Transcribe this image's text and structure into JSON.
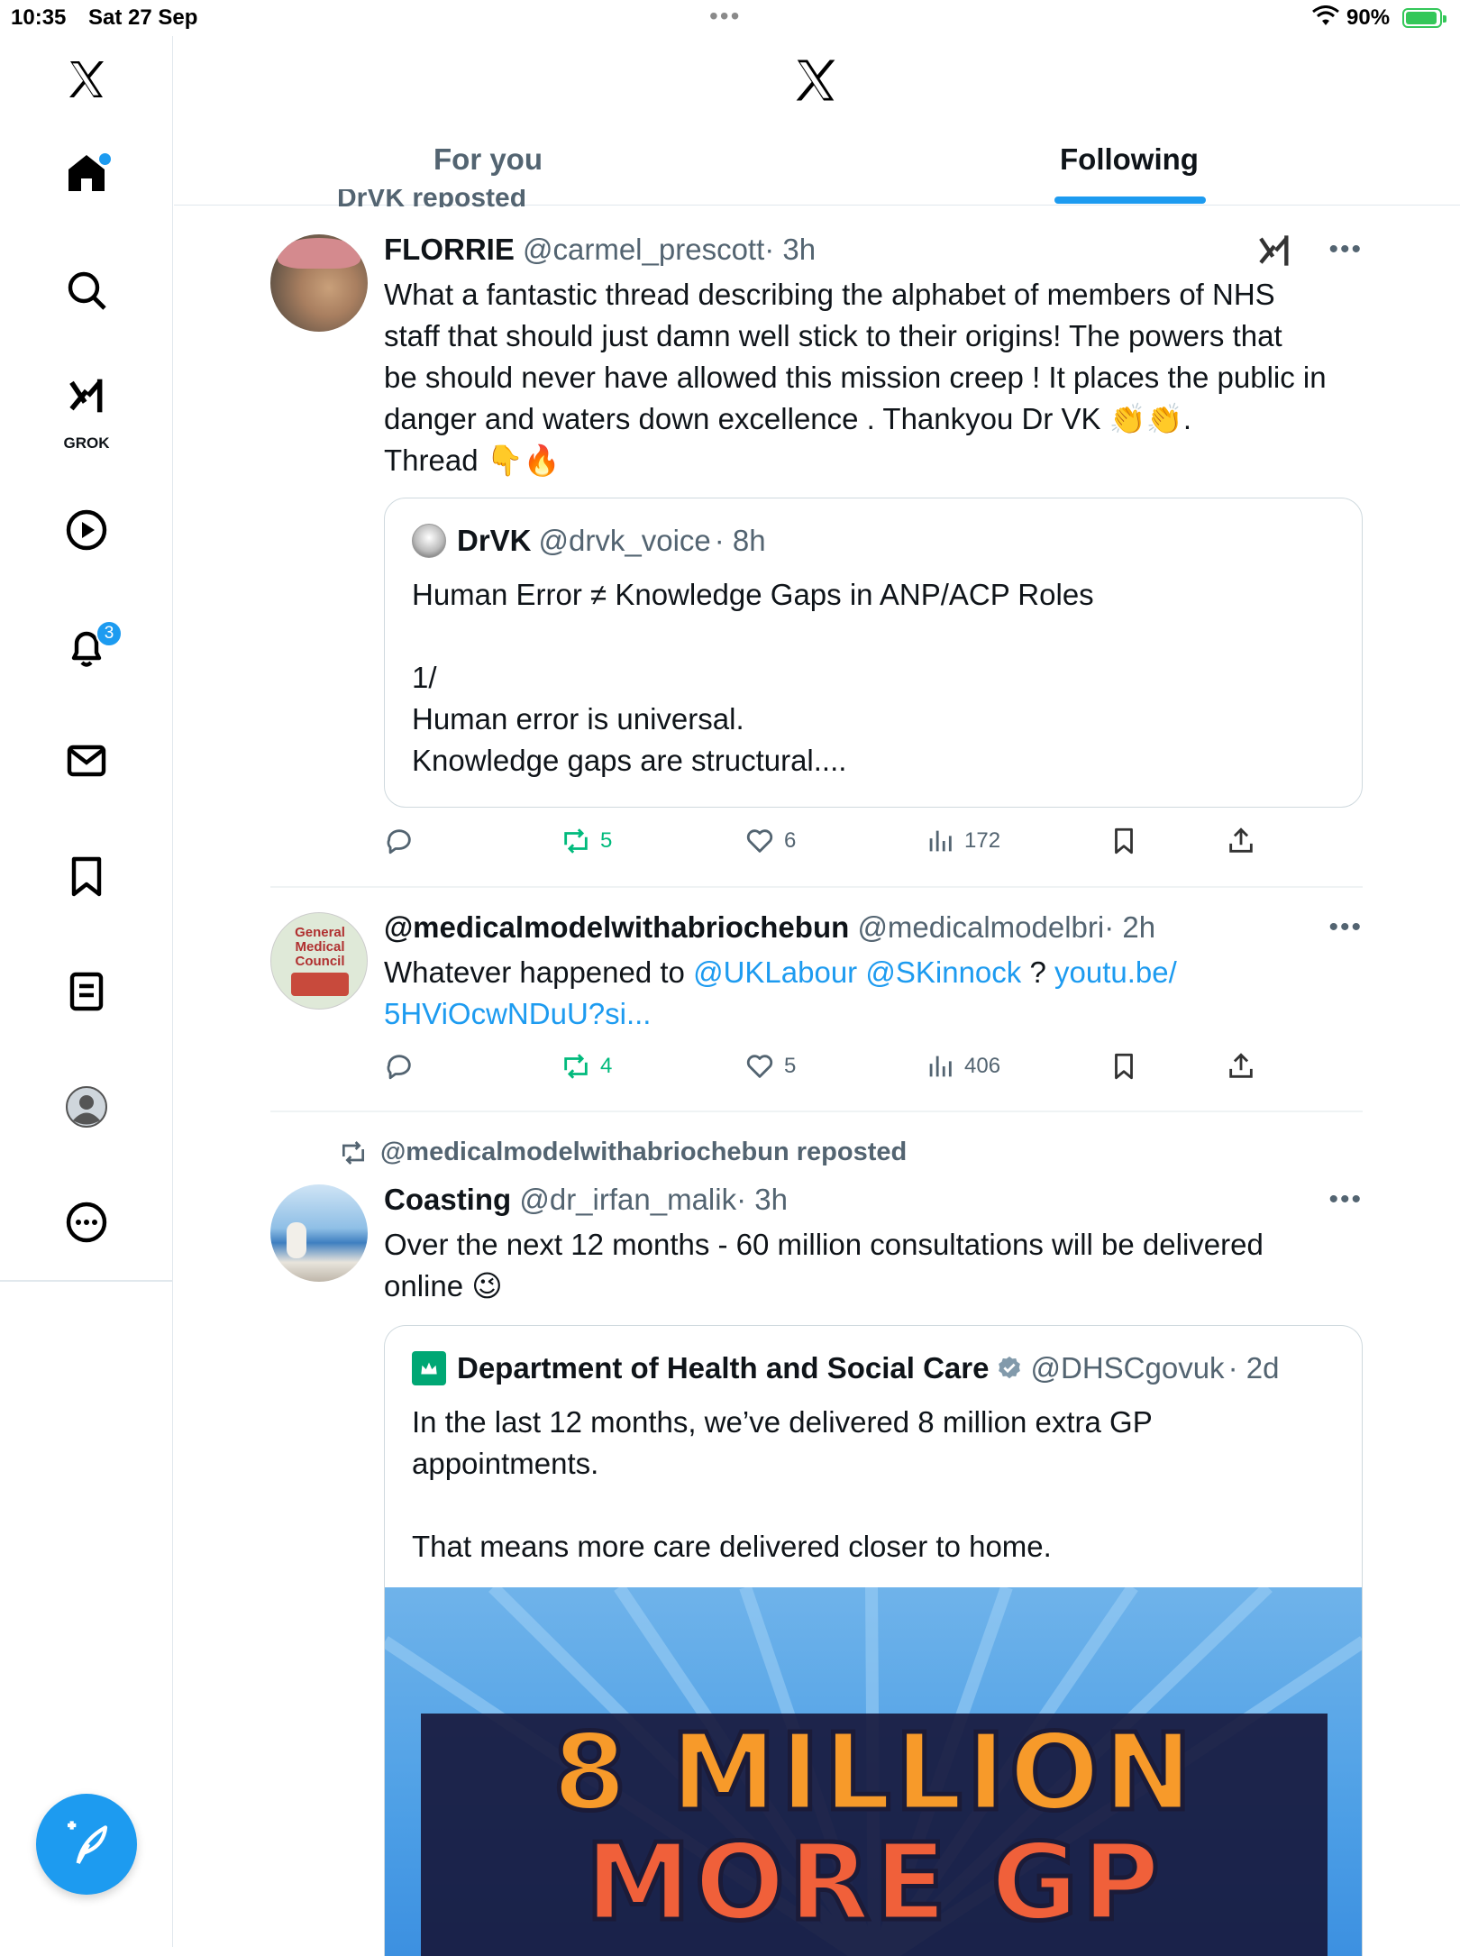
{
  "status": {
    "time": "10:35",
    "date": "Sat 27 Sep",
    "battery": "90%"
  },
  "sidebar": {
    "grok_label": "GROK",
    "notifications_count": "3"
  },
  "header": {
    "tabs": [
      {
        "label": "For you"
      },
      {
        "label": "Following"
      }
    ],
    "active_tab": "Following"
  },
  "feed": {
    "top_cut_repost": "DrVK reposted",
    "posts": [
      {
        "name": "FLORRIE",
        "handle": "@carmel_prescott",
        "time": "· 3h",
        "text_lines": [
          "What a fantastic thread describing the alphabet of members of NHS",
          "staff that should just damn well stick to their origins! The powers that",
          "be should never have allowed this mission creep ! It places the public in",
          "danger and waters down excellence . Thankyou Dr VK 👏👏.",
          "Thread 👇🔥"
        ],
        "quote": {
          "name": "DrVK",
          "handle": "@drvk_voice",
          "time": "· 8h",
          "text_lines": [
            "Human Error ≠ Knowledge Gaps in ANP/ACP Roles",
            "",
            "1/",
            "Human error is universal.",
            "Knowledge gaps are structural...."
          ]
        },
        "stats": {
          "reposts": "5",
          "likes": "6",
          "views": "172"
        }
      },
      {
        "name": "@medicalmodelwithabriochebun",
        "handle": "@medicalmodelbri",
        "time": "· 2h",
        "text_plain": "Whatever happened to ",
        "mention1": "@UKLabour",
        "mention2": "@SKinnock",
        "text_q": " ? ",
        "link1": "youtu.be/",
        "link2": "5HViOcwNDuU?si...",
        "avatar_text": [
          "General",
          "Medical",
          "Council"
        ],
        "stats": {
          "reposts": "4",
          "likes": "5",
          "views": "406"
        }
      },
      {
        "repost_label": "@medicalmodelwithabriochebun reposted",
        "name": "Coasting",
        "handle": "@dr_irfan_malik",
        "time": "· 3h",
        "text_lines": [
          "Over the next 12 months - 60 million consultations will be delivered",
          "online 😉"
        ],
        "quote": {
          "name": "Department of Health and Social Care",
          "handle": "@DHSCgovuk",
          "time": "· 2d",
          "text_lines": [
            "In the last 12 months, we’ve delivered 8 million extra GP",
            "appointments.",
            "",
            "That means more care delivered closer to home."
          ],
          "media_lines": [
            "8 MILLION",
            "MORE GP"
          ]
        }
      }
    ]
  },
  "colors": {
    "accent": "#1d9bf0",
    "repost_green": "#00ba7c",
    "muted": "#536471"
  }
}
